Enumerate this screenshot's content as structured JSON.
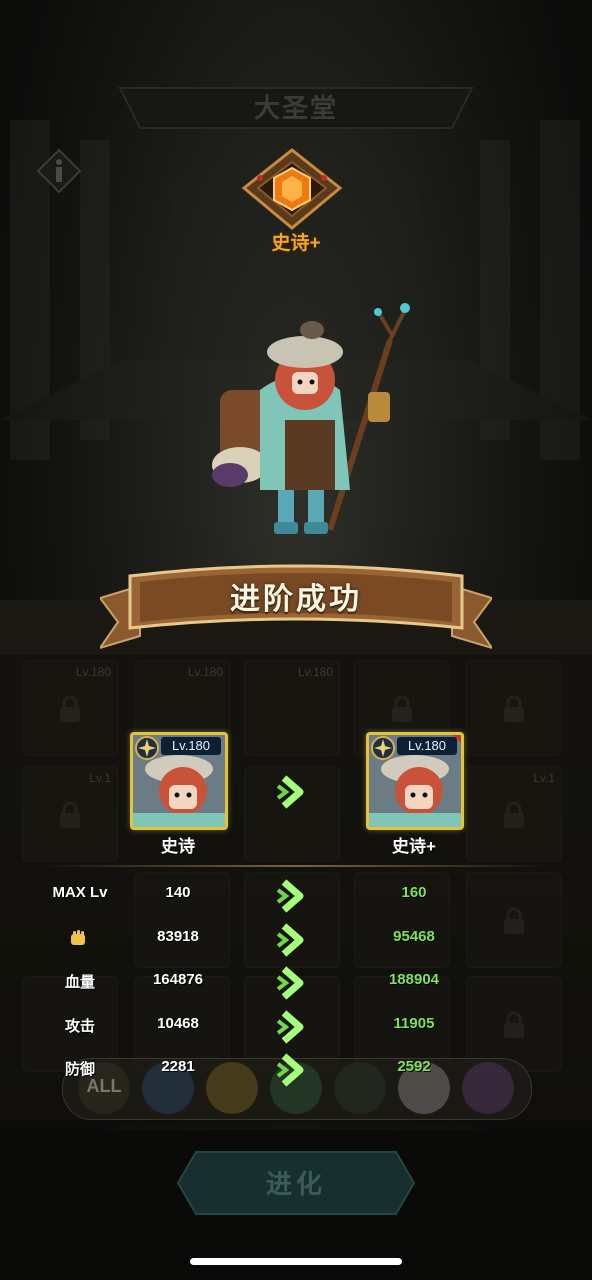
{
  "screen": {
    "title": "大圣堂",
    "banner": "进阶成功",
    "rank_badge_label": "史诗+",
    "evolve_button": "进化",
    "filter_all": "ALL"
  },
  "hero": {
    "before": {
      "level_tag": "Lv.180",
      "rarity": "史诗"
    },
    "after": {
      "level_tag": "Lv.180",
      "rarity": "史诗+"
    }
  },
  "background_slots": [
    {
      "level": "Lv.180"
    },
    {
      "level": "Lv.180"
    },
    {
      "level": "Lv.180"
    },
    {
      "level": ""
    },
    {
      "level": ""
    },
    {
      "level": "Lv.1"
    },
    {
      "level": ""
    },
    {
      "level": ""
    },
    {
      "level": ""
    },
    {
      "level": "Lv.1"
    }
  ],
  "stats": [
    {
      "label": "MAX Lv",
      "old": "140",
      "new": "160"
    },
    {
      "label": "",
      "icon": "power-icon",
      "old": "83918",
      "new": "95468"
    },
    {
      "label": "血量",
      "old": "164876",
      "new": "188904"
    },
    {
      "label": "攻击",
      "old": "10468",
      "new": "11905"
    },
    {
      "label": "防御",
      "old": "2281",
      "new": "2592"
    }
  ],
  "colors": {
    "gold": "#e4c23a",
    "stat_increase": "#7fe25a",
    "rank_orange": "#f5a623",
    "arrow_green": "#a6ff7a"
  }
}
